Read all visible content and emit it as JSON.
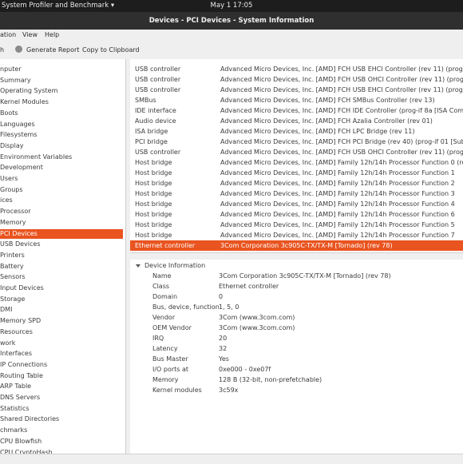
{
  "topbar": {
    "app": "System Profiler and Benchmark ▾",
    "clock": "May 1  17:05"
  },
  "window": {
    "title": "Devices - PCI Devices - System Information"
  },
  "menu": [
    "ation",
    "View",
    "Help"
  ],
  "toolbar": {
    "refresh": "h",
    "generate_report": "Generate Report",
    "copy": "Copy to Clipboard"
  },
  "sidebar": {
    "items": [
      "nputer",
      "Summary",
      "Operating System",
      "Kernel Modules",
      "Boots",
      "Languages",
      "Filesystems",
      "Display",
      "Environment Variables",
      "Development",
      "Users",
      "Groups",
      "ices",
      "Processor",
      "Memory",
      "PCI Devices",
      "USB Devices",
      "Printers",
      "Battery",
      "Sensors",
      "Input Devices",
      "Storage",
      "DMI",
      "Memory SPD",
      "Resources",
      "work",
      "Interfaces",
      "IP Connections",
      "Routing Table",
      "ARP Table",
      "DNS Servers",
      "Statistics",
      "Shared Directories",
      "chmarks",
      "CPU Blowfish",
      "CPU CryptoHash"
    ],
    "selected_index": 15
  },
  "devices": [
    {
      "type": "USB controller",
      "desc": "Advanced Micro Devices, Inc. [AMD] FCH USB EHCI Controller (rev 11) (prog-if 20 ["
    },
    {
      "type": "USB controller",
      "desc": "Advanced Micro Devices, Inc. [AMD] FCH USB OHCI Controller (rev 11) (prog-if 10 ["
    },
    {
      "type": "USB controller",
      "desc": "Advanced Micro Devices, Inc. [AMD] FCH USB EHCI Controller (rev 11) (prog-if 20 ["
    },
    {
      "type": "SMBus",
      "desc": "Advanced Micro Devices, Inc. [AMD] FCH SMBus Controller (rev 13)"
    },
    {
      "type": "IDE interface",
      "desc": "Advanced Micro Devices, Inc. [AMD] FCH IDE Controller (prog-if 8a [ISA Compatib"
    },
    {
      "type": "Audio device",
      "desc": "Advanced Micro Devices, Inc. [AMD] FCH Azalia Controller (rev 01)"
    },
    {
      "type": "ISA bridge",
      "desc": "Advanced Micro Devices, Inc. [AMD] FCH LPC Bridge (rev 11)"
    },
    {
      "type": "PCI bridge",
      "desc": "Advanced Micro Devices, Inc. [AMD] FCH PCI Bridge (rev 40) (prog-if 01 [Subtractiv"
    },
    {
      "type": "USB controller",
      "desc": "Advanced Micro Devices, Inc. [AMD] FCH USB OHCI Controller (rev 11) (prog-if 10 ["
    },
    {
      "type": "Host bridge",
      "desc": "Advanced Micro Devices, Inc. [AMD] Family 12h/14h Processor Function 0 (rev 43)"
    },
    {
      "type": "Host bridge",
      "desc": "Advanced Micro Devices, Inc. [AMD] Family 12h/14h Processor Function 1"
    },
    {
      "type": "Host bridge",
      "desc": "Advanced Micro Devices, Inc. [AMD] Family 12h/14h Processor Function 2"
    },
    {
      "type": "Host bridge",
      "desc": "Advanced Micro Devices, Inc. [AMD] Family 12h/14h Processor Function 3"
    },
    {
      "type": "Host bridge",
      "desc": "Advanced Micro Devices, Inc. [AMD] Family 12h/14h Processor Function 4"
    },
    {
      "type": "Host bridge",
      "desc": "Advanced Micro Devices, Inc. [AMD] Family 12h/14h Processor Function 6"
    },
    {
      "type": "Host bridge",
      "desc": "Advanced Micro Devices, Inc. [AMD] Family 12h/14h Processor Function 5"
    },
    {
      "type": "Host bridge",
      "desc": "Advanced Micro Devices, Inc. [AMD] Family 12h/14h Processor Function 7"
    },
    {
      "type": "Ethernet controller",
      "desc": "3Com Corporation 3c905C-TX/TX-M [Tornado] (rev 78)"
    }
  ],
  "selected_device_index": 17,
  "info": {
    "section": "Device Information",
    "props": [
      {
        "k": "Name",
        "v": "3Com Corporation 3c905C-TX/TX-M [Tornado] (rev 78)"
      },
      {
        "k": "Class",
        "v": "Ethernet controller"
      },
      {
        "k": "Domain",
        "v": "0"
      },
      {
        "k": "Bus, device, function",
        "v": "1, 5, 0"
      },
      {
        "k": "Vendor",
        "v": "3Com (www.3com.com)"
      },
      {
        "k": "OEM Vendor",
        "v": "3Com (www.3com.com)"
      },
      {
        "k": "IRQ",
        "v": "20"
      },
      {
        "k": "Latency",
        "v": "32"
      },
      {
        "k": "Bus Master",
        "v": "Yes"
      },
      {
        "k": "I/O ports at",
        "v": "0xe000 - 0xe07f"
      },
      {
        "k": "Memory",
        "v": "128 B (32-bit, non-prefetchable)"
      },
      {
        "k": "Kernel modules",
        "v": "3c59x"
      }
    ]
  },
  "colors": {
    "accent": "#e95420"
  }
}
